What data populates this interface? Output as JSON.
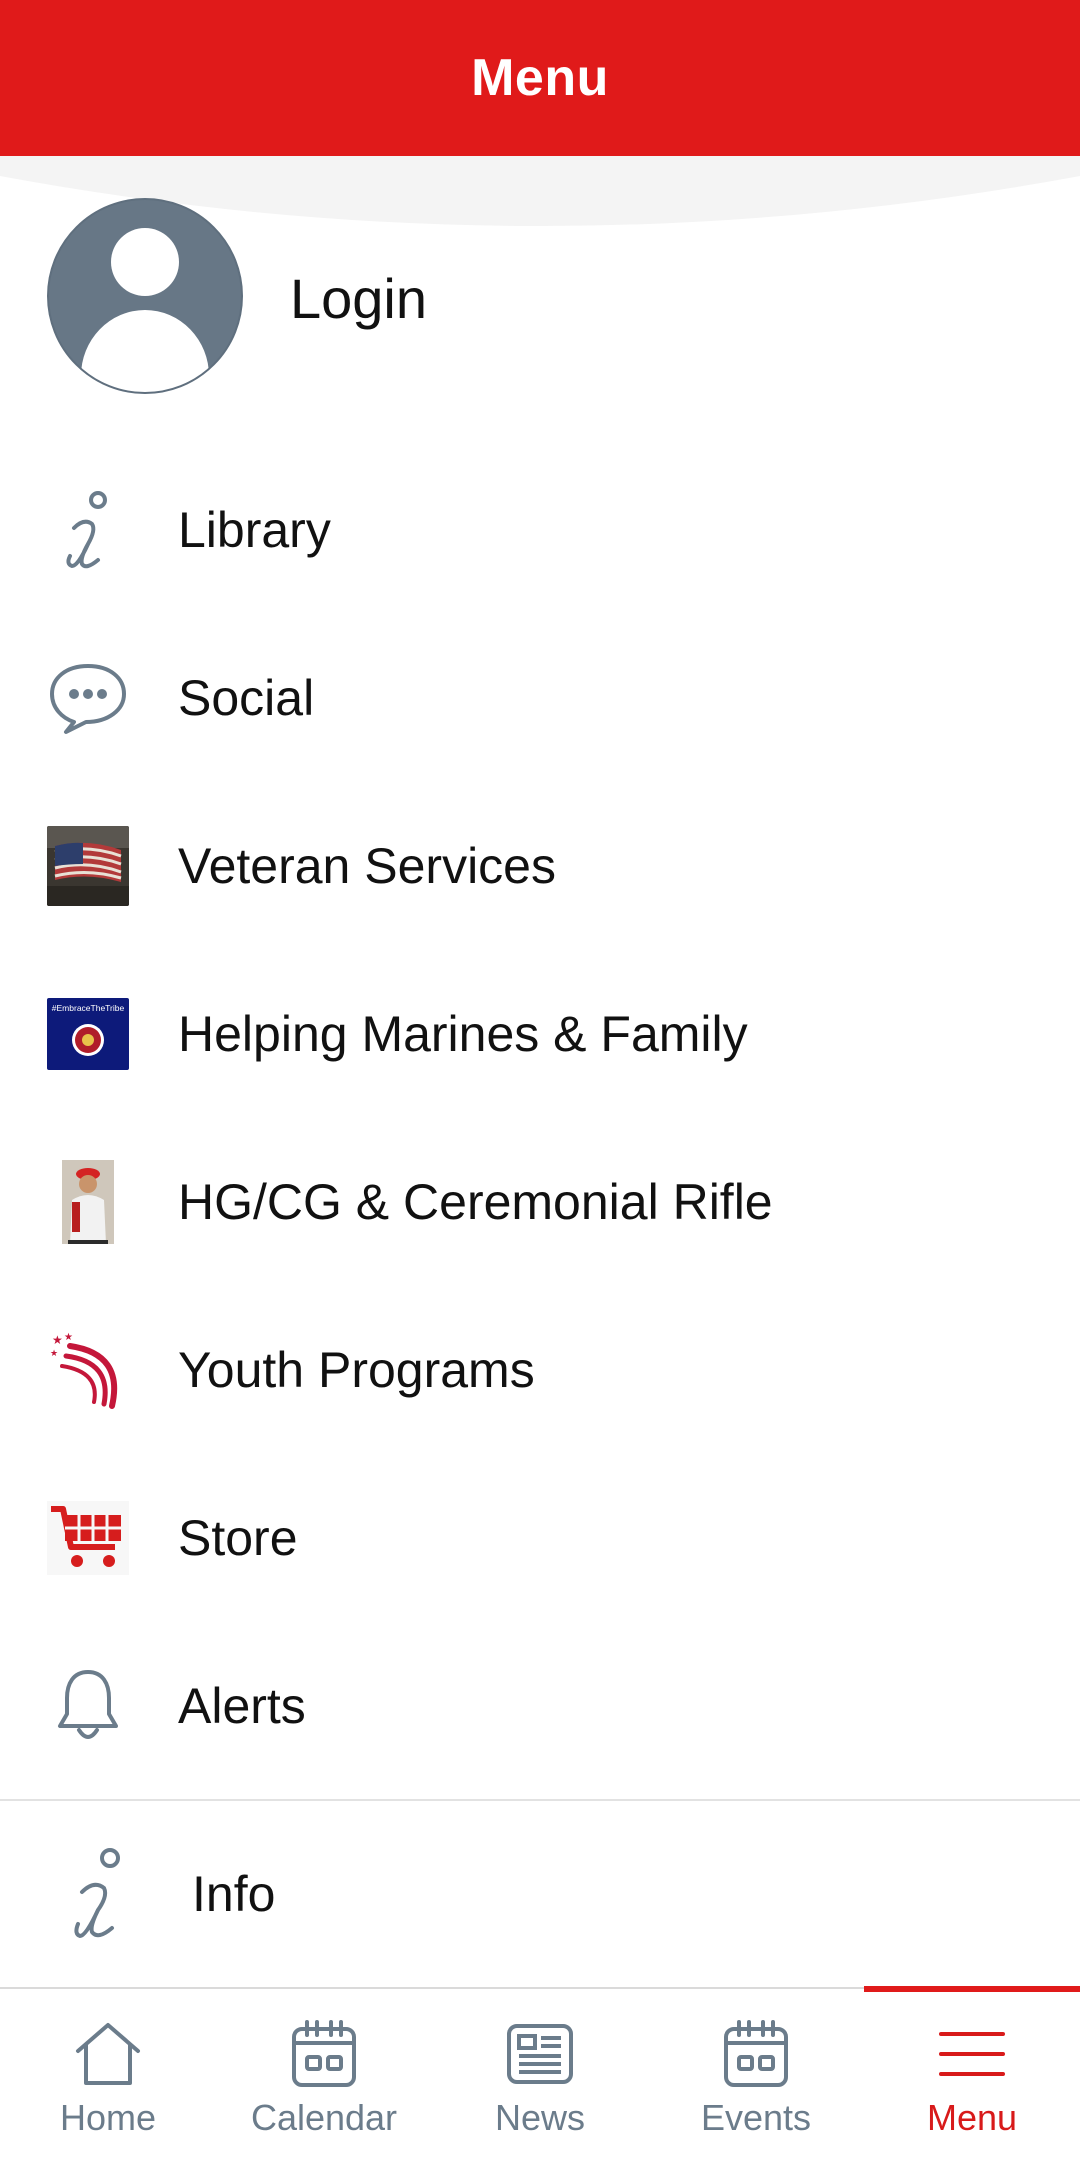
{
  "header": {
    "title": "Menu"
  },
  "account": {
    "login_label": "Login"
  },
  "menu": {
    "items": [
      {
        "label": "Library",
        "icon": "info-icon"
      },
      {
        "label": "Social",
        "icon": "chat-bubble-icon"
      },
      {
        "label": "Veteran Services",
        "icon": "flag-thumbnail"
      },
      {
        "label": "Helping Marines & Family",
        "icon": "embrace-the-tribe-thumbnail",
        "thumbnail_text": "#EmbraceTheTribe"
      },
      {
        "label": "HG/CG & Ceremonial Rifle",
        "icon": "marine-photo-thumbnail"
      },
      {
        "label": "Youth Programs",
        "icon": "stars-swoosh-logo"
      },
      {
        "label": "Store",
        "icon": "shopping-cart-icon"
      },
      {
        "label": "Alerts",
        "icon": "bell-icon"
      }
    ],
    "info": {
      "label": "Info",
      "icon": "info-icon"
    }
  },
  "tabbar": {
    "tabs": [
      {
        "label": "Home",
        "icon": "home-icon",
        "active": false
      },
      {
        "label": "Calendar",
        "icon": "calendar-icon",
        "active": false
      },
      {
        "label": "News",
        "icon": "news-icon",
        "active": false
      },
      {
        "label": "Events",
        "icon": "calendar-icon",
        "active": false
      },
      {
        "label": "Menu",
        "icon": "hamburger-icon",
        "active": true
      }
    ]
  },
  "colors": {
    "brand_red": "#e01a1a",
    "icon_gray": "#6b7c8b",
    "avatar_gray": "#677786"
  }
}
